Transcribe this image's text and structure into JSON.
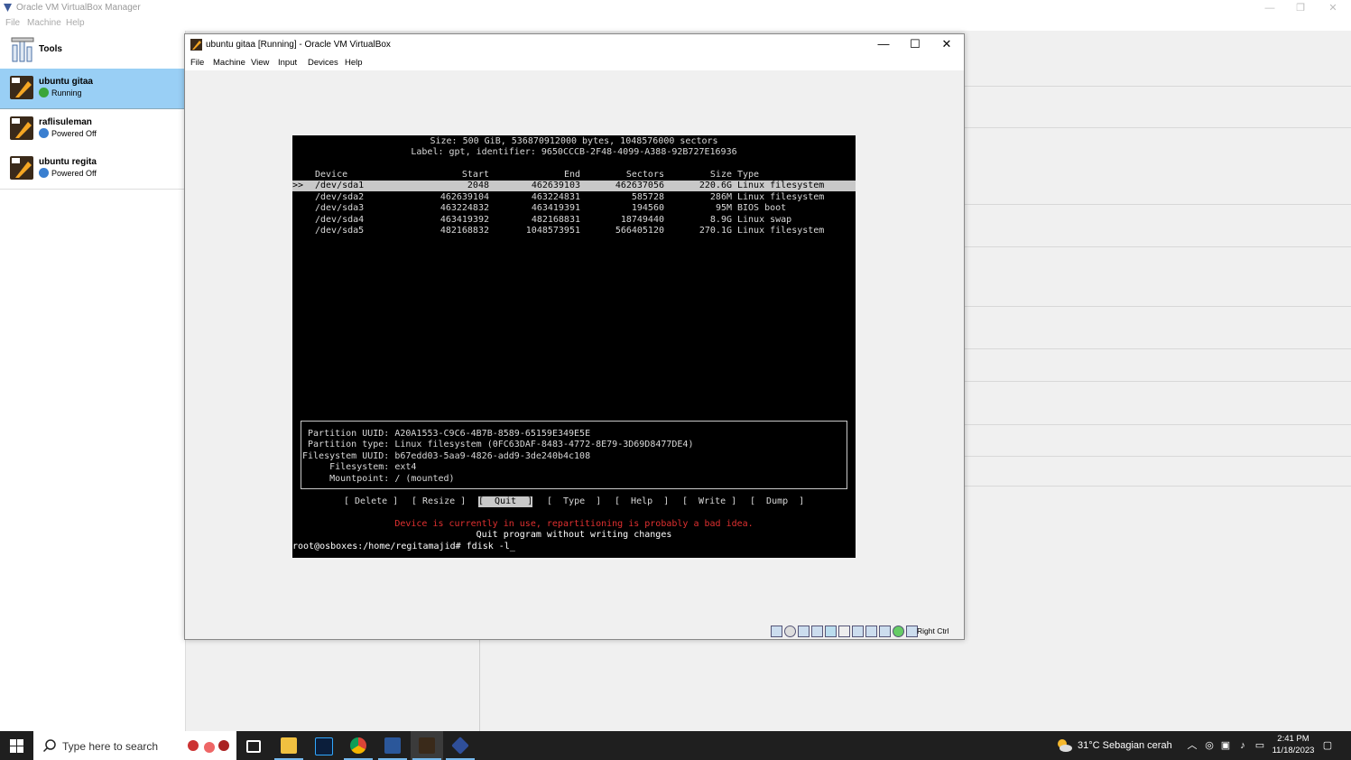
{
  "manager": {
    "title": "Oracle VM VirtualBox Manager",
    "menu": [
      "File",
      "Machine",
      "Help"
    ],
    "tools_label": "Tools",
    "vms": [
      {
        "name": "ubuntu gitaa",
        "status": "Running",
        "status_color": "#3aa53a",
        "selected": true
      },
      {
        "name": "raflisuleman",
        "status": "Powered Off",
        "status_color": "#3a7fd0",
        "selected": false
      },
      {
        "name": "ubuntu regita",
        "status": "Powered Off",
        "status_color": "#3a7fd0",
        "selected": false
      }
    ]
  },
  "vm_window": {
    "title": "ubuntu gitaa [Running] - Oracle VM VirtualBox",
    "menu": [
      "File",
      "Machine",
      "View",
      "Input",
      "Devices",
      "Help"
    ],
    "minimize_glyph": "—",
    "maximize_glyph": "☐",
    "close_glyph": "✕",
    "host_key": "Right Ctrl"
  },
  "terminal": {
    "header_size": "Size: 500 GiB, 536870912000 bytes, 1048576000 sectors",
    "header_label": "Label: gpt, identifier: 9650CCCB-2F48-4099-A388-92B727E16936",
    "columns": [
      "Device",
      "Start",
      "End",
      "Sectors",
      "Size",
      "Type"
    ],
    "cursor": ">>",
    "rows": [
      {
        "device": "/dev/sda1",
        "start": "2048",
        "end": "462639103",
        "sectors": "462637056",
        "size": "220.6G",
        "type": "Linux filesystem"
      },
      {
        "device": "/dev/sda2",
        "start": "462639104",
        "end": "463224831",
        "sectors": "585728",
        "size": "286M",
        "type": "Linux filesystem"
      },
      {
        "device": "/dev/sda3",
        "start": "463224832",
        "end": "463419391",
        "sectors": "194560",
        "size": "95M",
        "type": "BIOS boot"
      },
      {
        "device": "/dev/sda4",
        "start": "463419392",
        "end": "482168831",
        "sectors": "18749440",
        "size": "8.9G",
        "type": "Linux swap"
      },
      {
        "device": "/dev/sda5",
        "start": "482168832",
        "end": "1048573951",
        "sectors": "566405120",
        "size": "270.1G",
        "type": "Linux filesystem"
      }
    ],
    "info": [
      " Partition UUID: A20A1553-C9C6-4B7B-8589-65159E349E5E",
      " Partition type: Linux filesystem (0FC63DAF-8483-4772-8E79-3D69D8477DE4)",
      "Filesystem UUID: b67edd03-5aa9-4826-add9-3de240b4c108",
      "     Filesystem: ext4",
      "     Mountpoint: / (mounted)"
    ],
    "buttons": [
      "[ Delete ]",
      "[ Resize ]",
      "[  Quit  ]",
      "[  Type  ]",
      "[  Help  ]",
      "[  Write ]",
      "[  Dump  ]"
    ],
    "selected_button_index": 2,
    "warning": "Device is currently in use, repartitioning is probably a bad idea.",
    "hint": "Quit program without writing changes",
    "prompt": "root@osboxes:/home/regitamajid# fdisk -l",
    "prompt_cursor": "_"
  },
  "taskbar": {
    "search_placeholder": "Type here to search",
    "weather": "31°C  Sebagian cerah",
    "time": "2:41 PM",
    "date": "11/18/2023"
  },
  "colors": {
    "selection": "#99cff5",
    "terminal_bg": "#000000",
    "terminal_warning": "#e03030"
  }
}
